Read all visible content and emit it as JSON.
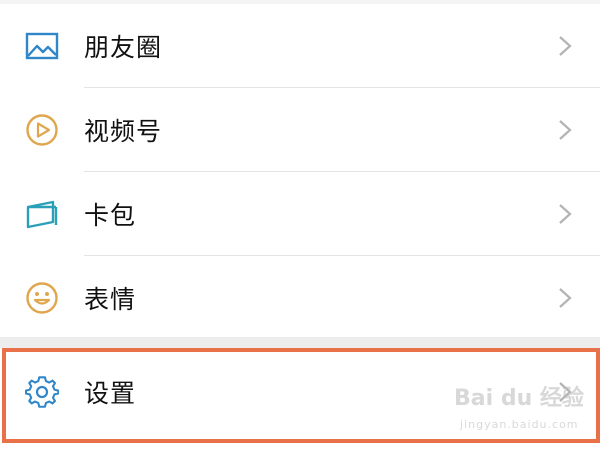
{
  "menu": {
    "items": [
      {
        "label": "朋友圈",
        "icon": "moments-icon",
        "color": "#2f86c8"
      },
      {
        "label": "视频号",
        "icon": "video-channel-icon",
        "color": "#e0a64e"
      },
      {
        "label": "卡包",
        "icon": "card-wallet-icon",
        "color": "#2aa0b8"
      },
      {
        "label": "表情",
        "icon": "sticker-icon",
        "color": "#e0a64e"
      }
    ],
    "settings": {
      "label": "设置",
      "icon": "gear-icon",
      "color": "#2f86c8"
    }
  },
  "highlight_color": "#e8714a",
  "watermark": {
    "main": "Bai du 经验",
    "sub": "jingyan.baidu.com"
  }
}
